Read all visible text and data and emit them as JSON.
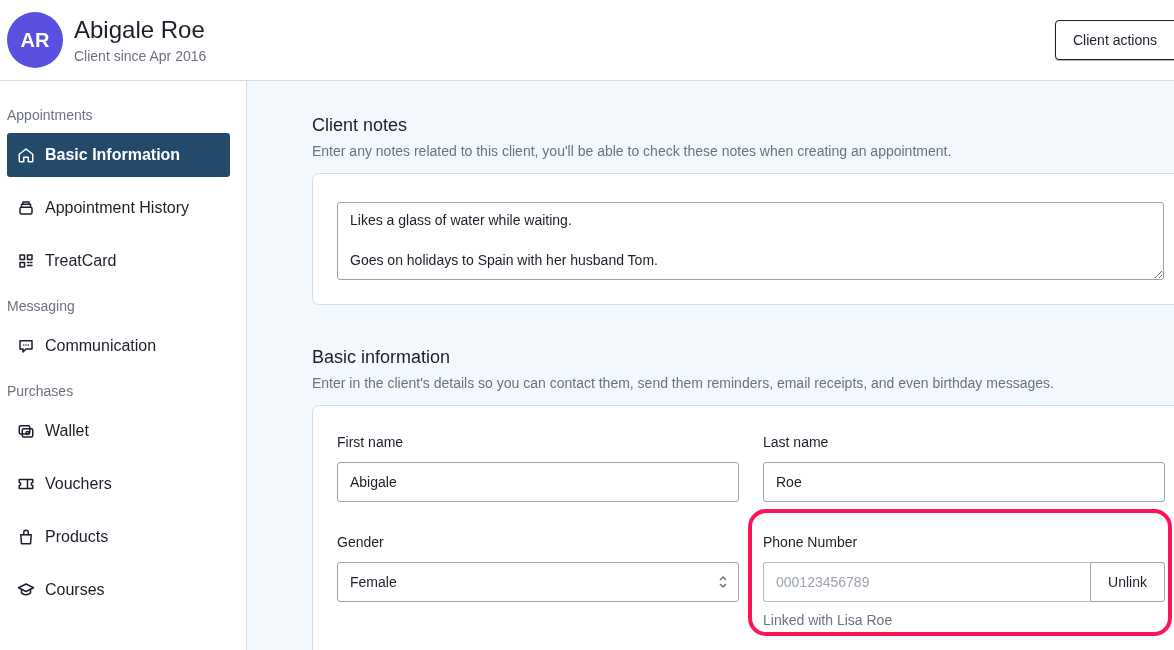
{
  "header": {
    "avatar_initials": "AR",
    "client_name": "Abigale Roe",
    "client_since": "Client since Apr 2016",
    "actions_button": "Client actions"
  },
  "sidebar": {
    "groups": [
      {
        "label": "Appointments",
        "items": [
          {
            "label": "Basic Information",
            "selected": true
          },
          {
            "label": "Appointment History",
            "selected": false
          },
          {
            "label": "TreatCard",
            "selected": false
          }
        ]
      },
      {
        "label": "Messaging",
        "items": [
          {
            "label": "Communication",
            "selected": false
          }
        ]
      },
      {
        "label": "Purchases",
        "items": [
          {
            "label": "Wallet",
            "selected": false
          },
          {
            "label": "Vouchers",
            "selected": false
          },
          {
            "label": "Products",
            "selected": false
          },
          {
            "label": "Courses",
            "selected": false
          }
        ]
      }
    ]
  },
  "client_notes": {
    "title": "Client notes",
    "description": "Enter any notes related to this client, you'll be able to check these notes when creating an appointment.",
    "value": "Likes a glass of water while waiting.\n\nGoes on holidays to Spain with her husband Tom."
  },
  "basic_information": {
    "title": "Basic information",
    "description": "Enter in the client's details so you can contact them, send them reminders, email receipts, and even birthday messages.",
    "fields": [
      {
        "kind": "text",
        "label": "First name",
        "value": "Abigale"
      },
      {
        "kind": "text",
        "label": "Last name",
        "value": "Roe"
      },
      {
        "kind": "select",
        "label": "Gender",
        "value": "Female"
      },
      {
        "kind": "linked",
        "label": "Phone Number",
        "value": "000123456789",
        "disabled": true,
        "button": "Unlink",
        "hint": "Linked with Lisa Roe",
        "highlighted": true
      }
    ]
  }
}
